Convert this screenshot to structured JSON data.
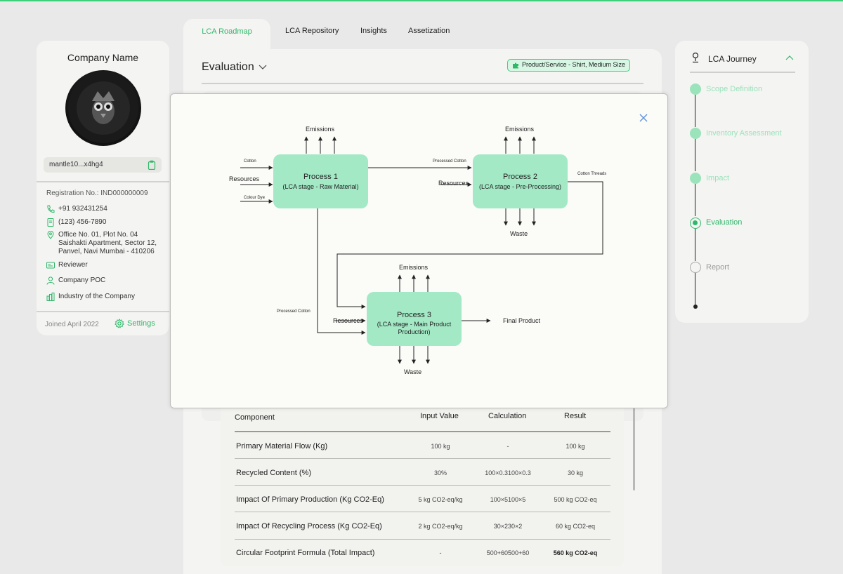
{
  "company": {
    "name": "Company Name",
    "wallet": "mantle10...x4hg4",
    "registration": "Registration No.: IND000000009",
    "phone": "+91 932431254",
    "fax": "(123) 456-7890",
    "address": "Office No. 01, Plot No.  04\nSaishakti Apartment, Sector 12,\nPanvel, Navi Mumbai - 410206",
    "reviewer": "Reviewer",
    "poc": "Company POC",
    "industry": "Industry of the Company",
    "joined": "Joined April 2022",
    "settings": "Settings"
  },
  "tabs": [
    "LCA Roadmap",
    "LCA Repository",
    "Insights",
    "Assetization"
  ],
  "main": {
    "title": "Evaluation",
    "product_pill": "Product/Service - Shirt, Medium Size"
  },
  "journey": {
    "title": "LCA Journey",
    "steps": [
      "Scope Definition",
      "Inventory Assessment",
      "Impact",
      "Evaluation",
      "Report"
    ]
  },
  "diagram": {
    "p1": {
      "title": "Process 1",
      "sub": "(LCA stage - Raw Material)"
    },
    "p2": {
      "title": "Process 2",
      "sub": "(LCA stage - Pre-Processing)"
    },
    "p3": {
      "title": "Process 3",
      "sub": "(LCA stage - Main Product Production)"
    },
    "emissions": "Emissions",
    "waste": "Waste",
    "resources": "Resources",
    "cotton": "Cotton",
    "colour_dye": "Colour Dye",
    "processed_cotton": "Processed Cotton",
    "cotton_threads": "Cotton Threads",
    "final_product": "Final Product"
  },
  "table": {
    "headers": [
      "Component",
      "Input Value",
      "Calculation",
      "Result"
    ],
    "rows": [
      [
        "Primary Material Flow (Kg)",
        "100 kg",
        "-",
        "100 kg"
      ],
      [
        "Recycled Content (%)",
        "30%",
        "100×0.3100×0.3",
        "30 kg"
      ],
      [
        "Impact Of Primary Production (Kg CO2-Eq)",
        "5 kg CO2-eq/kg",
        "100×5100×5",
        "500 kg CO2-eq"
      ],
      [
        "Impact Of Recycling Process (Kg CO2-Eq)",
        "2 kg CO2-eq/kg",
        "30×230×2",
        "60 kg CO2-eq"
      ],
      [
        "Circular Footprint Formula (Total Impact)",
        "-",
        "500+60500+60",
        "560 kg CO2-eq"
      ]
    ]
  },
  "colors": {
    "accent": "#2fb86a",
    "process_fill": "#a3e9c6",
    "step_done": "#9ae3bb"
  }
}
